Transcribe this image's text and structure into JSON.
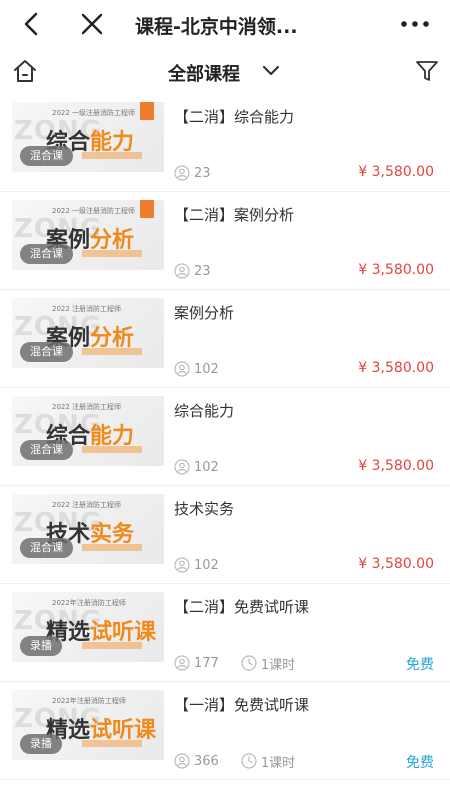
{
  "header": {
    "title": "课程-北京中消领..."
  },
  "filter": {
    "title": "全部课程"
  },
  "courses": [
    {
      "title": "【二消】综合能力",
      "thumb_big": "综合",
      "thumb_big_hl": "能力",
      "thumb_small": "2022 一级注册消防工程师",
      "badge": "混合课",
      "students": "23",
      "price": "¥ 3,580.00",
      "hours": ""
    },
    {
      "title": "【二消】案例分析",
      "thumb_big": "案例",
      "thumb_big_hl": "分析",
      "thumb_small": "2022 一级注册消防工程师",
      "badge": "混合课",
      "students": "23",
      "price": "¥ 3,580.00",
      "hours": ""
    },
    {
      "title": "案例分析",
      "thumb_big": "案例",
      "thumb_big_hl": "分析",
      "thumb_small": "2022 注册消防工程师",
      "badge": "混合课",
      "students": "102",
      "price": "¥ 3,580.00",
      "hours": ""
    },
    {
      "title": "综合能力",
      "thumb_big": "综合",
      "thumb_big_hl": "能力",
      "thumb_small": "2022 注册消防工程师",
      "badge": "混合课",
      "students": "102",
      "price": "¥ 3,580.00",
      "hours": ""
    },
    {
      "title": "技术实务",
      "thumb_big": "技术",
      "thumb_big_hl": "实务",
      "thumb_small": "2022 注册消防工程师",
      "badge": "混合课",
      "students": "102",
      "price": "¥ 3,580.00",
      "hours": ""
    },
    {
      "title": "【二消】免费试听课",
      "thumb_big": "精选",
      "thumb_big_hl": "试听课",
      "thumb_small": "2022年注册消防工程师",
      "badge": "录播",
      "students": "177",
      "price": "免费",
      "hours": "1课时"
    },
    {
      "title": "【一消】免费试听课",
      "thumb_big": "精选",
      "thumb_big_hl": "试听课",
      "thumb_small": "2022年注册消防工程师",
      "badge": "录播",
      "students": "366",
      "price": "免费",
      "hours": "1课时"
    }
  ],
  "colors": {
    "price": "#e3463c",
    "free": "#27a5d8",
    "accent": "#f08a1c"
  }
}
